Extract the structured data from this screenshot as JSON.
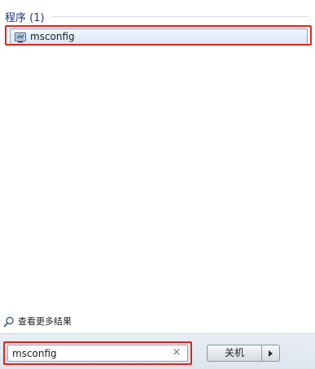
{
  "results": {
    "section_title": "程序 (1)",
    "items": [
      {
        "label": "msconfig",
        "icon": "system-configuration-icon"
      }
    ]
  },
  "see_more": {
    "label": "查看更多结果",
    "icon": "search-icon"
  },
  "search": {
    "value": "msconfig",
    "clear_glyph": "×"
  },
  "shutdown": {
    "label": "关机",
    "arrow_icon": "chevron-right-icon"
  },
  "colors": {
    "highlight": "#e2231a",
    "section_title": "#1e3287",
    "selection_border": "#7da2ce"
  }
}
